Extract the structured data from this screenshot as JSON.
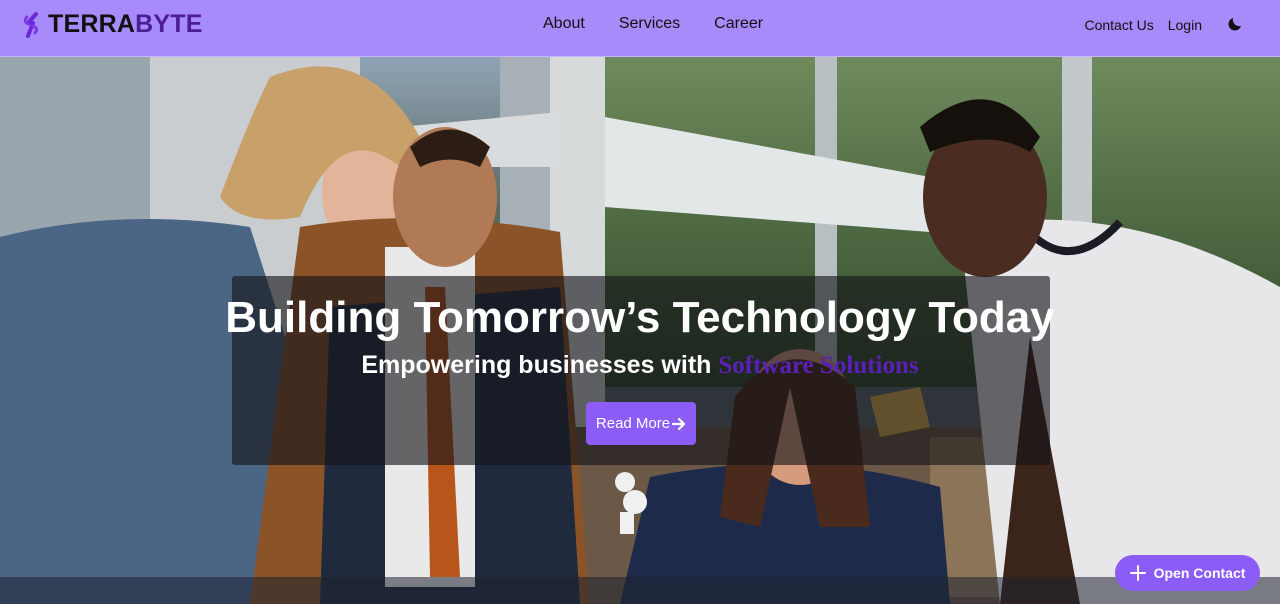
{
  "brand": {
    "name_part1": "TERRA",
    "name_part2": "BYTE",
    "logo_icon": "bolt-s-icon",
    "colors": {
      "primary": "#a78bfa",
      "accent": "#8b5cf6",
      "brand_dark": "#4c1d95"
    }
  },
  "nav": {
    "links": [
      "About",
      "Services",
      "Career"
    ]
  },
  "header_right": {
    "contact": "Contact Us",
    "login": "Login",
    "theme_icon": "moon-icon"
  },
  "hero": {
    "headline": "Building Tomorrow’s Technology Today",
    "subline_lead": "Empowering businesses with",
    "subline_accent": "Software Solutions",
    "cta_label": "Read More",
    "cta_icon": "arrow-right-icon"
  },
  "floating": {
    "open_contact": "Open Contact",
    "icon": "plus-icon"
  }
}
